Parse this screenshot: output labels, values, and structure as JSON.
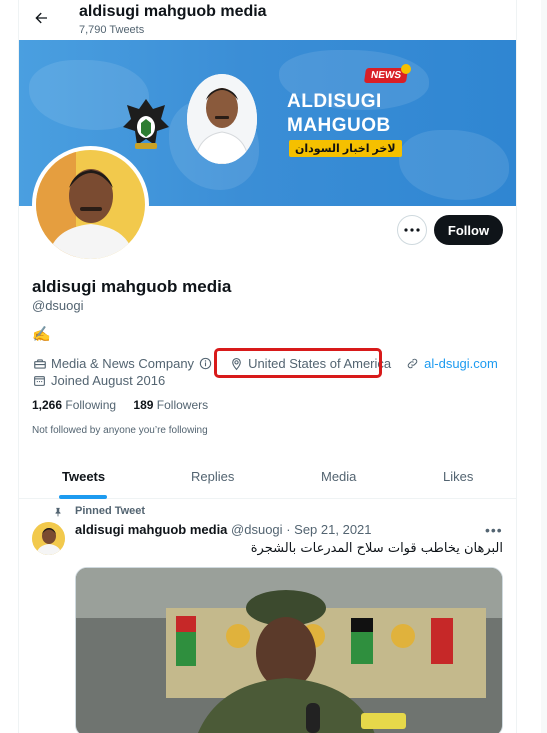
{
  "header": {
    "back_label": "",
    "display_name": "aldisugi mahguob media",
    "tweet_count": "7,790 Tweets"
  },
  "banner": {
    "title_line1": "ALDISUGI",
    "title_line2": "MAHGUOB",
    "subtitle": "لاخر اخبار السودان",
    "news_badge": "NEWS"
  },
  "actions": {
    "more_label": "•••",
    "follow_label": "Follow"
  },
  "profile": {
    "name": "aldisugi mahguob media",
    "handle": "@dsuogi",
    "bio": "✍️",
    "category": "Media & News Company",
    "location": "United States of America",
    "website": "al-dsugi.com",
    "joined": "Joined August 2016",
    "following_count": "1,266",
    "following_label": "Following",
    "followers_count": "189",
    "followers_label": "Followers",
    "not_followed": "Not followed by anyone you’re following"
  },
  "tabs": [
    {
      "label": "Tweets",
      "active": true
    },
    {
      "label": "Replies",
      "active": false
    },
    {
      "label": "Media",
      "active": false
    },
    {
      "label": "Likes",
      "active": false
    }
  ],
  "tweet": {
    "pinned_label": "Pinned Tweet",
    "author_name": "aldisugi mahguob media",
    "author_handle": "@dsuogi",
    "separator": "·",
    "date": "Sep 21, 2021",
    "more_label": "•••",
    "text": "البرهان يخاطب قوات سلاح المدرعات بالشجرة"
  },
  "colors": {
    "accent": "#1d9bf0",
    "follow_bg": "#0f1419",
    "highlight": "#d81a1a",
    "banner": "#3b8ed6"
  }
}
